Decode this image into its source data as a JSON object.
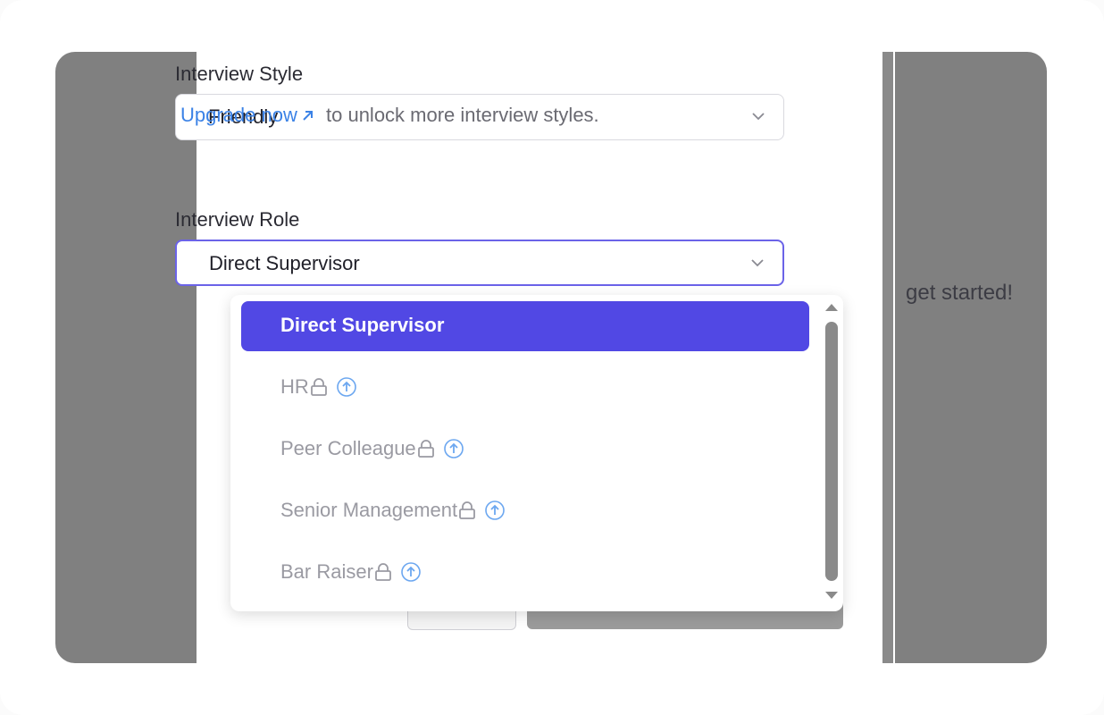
{
  "form": {
    "style_label": "Interview Style",
    "style_value": "Friendly",
    "upgrade_link": "Upgrade now",
    "upgrade_suffix": "to unlock more interview styles.",
    "role_label": "Interview Role",
    "role_value": "Direct Supervisor"
  },
  "dropdown": {
    "options": [
      {
        "label": "Direct Supervisor",
        "locked": false,
        "selected": true
      },
      {
        "label": "HR",
        "locked": true,
        "selected": false
      },
      {
        "label": "Peer Colleague",
        "locked": true,
        "selected": false
      },
      {
        "label": "Senior Management",
        "locked": true,
        "selected": false
      },
      {
        "label": "Bar Raiser",
        "locked": true,
        "selected": false
      }
    ]
  },
  "background": {
    "side_text": "get started!"
  },
  "colors": {
    "accent": "#5148e4",
    "link": "#3b82e6",
    "overlay": "#808080"
  },
  "icons": {
    "chevron": "chevron-down-icon",
    "lock": "lock-icon",
    "upgrade": "arrow-up-circle-icon",
    "external": "arrow-up-right-icon"
  }
}
